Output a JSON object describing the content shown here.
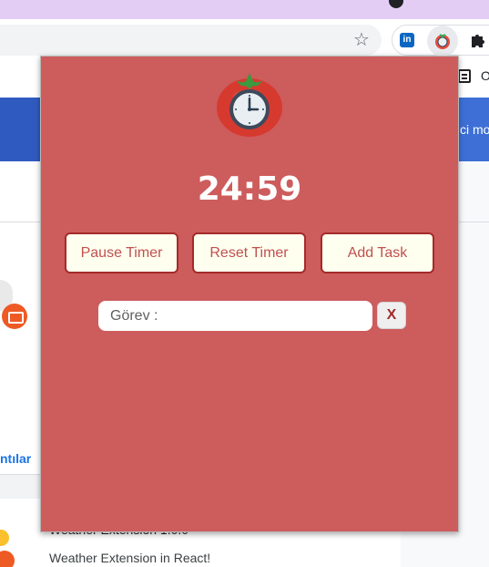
{
  "browser": {
    "star_icon": "star-icon",
    "extensions": [
      "linkedin-icon",
      "tomato-timer-icon",
      "puzzle-icon"
    ],
    "linkedin_label": "in"
  },
  "page": {
    "top_right_text": "O",
    "header_text": "ci mo",
    "card1_link": "ntılar",
    "card2_title": "Weather Extension  1.0.0",
    "card2_desc": "Weather Extension in React!"
  },
  "popup": {
    "timer": "24:59",
    "buttons": {
      "pause": "Pause Timer",
      "reset": "Reset Timer",
      "add_task": "Add Task"
    },
    "task_input": {
      "placeholder": "Görev :",
      "value": ""
    },
    "clear_label": "X"
  },
  "colors": {
    "popup_bg": "#cd5c5c",
    "button_bg": "#fffff0",
    "button_border": "#a52a2a",
    "button_text": "#c0504d"
  }
}
